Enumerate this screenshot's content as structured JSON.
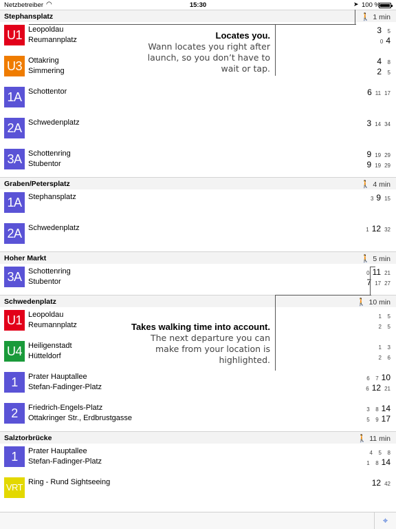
{
  "status_bar": {
    "carrier": "Netzbetreiber",
    "time": "15:30",
    "battery": "100 %"
  },
  "stations": [
    {
      "name": "Stephansplatz",
      "walk": "1 min",
      "rows": [
        {
          "line": "U1",
          "color": "#e2001a",
          "dests": [
            "Leopoldau",
            "Reumannplatz"
          ],
          "times": [
            [
              "3",
              "5"
            ],
            [
              "0",
              "4"
            ]
          ],
          "big": [
            0,
            1
          ]
        },
        {
          "line": "U3",
          "color": "#ef7c00",
          "dests": [
            "Ottakring",
            "Simmering"
          ],
          "times": [
            [
              "4",
              "8"
            ],
            [
              "2",
              "5"
            ]
          ],
          "big": [
            0,
            0
          ]
        },
        {
          "line": "1A",
          "color": "#5a53d6",
          "dests": [
            "Schottentor"
          ],
          "times": [
            [
              "6",
              "11",
              "17"
            ]
          ],
          "big": [
            0
          ]
        },
        {
          "line": "2A",
          "color": "#5a53d6",
          "dests": [
            "Schwedenplatz"
          ],
          "times": [
            [
              "3",
              "14",
              "34"
            ]
          ],
          "big": [
            0
          ]
        },
        {
          "line": "3A",
          "color": "#5a53d6",
          "dests": [
            "Schottenring",
            "Stubentor"
          ],
          "times": [
            [
              "9",
              "19",
              "29"
            ],
            [
              "9",
              "19",
              "29"
            ]
          ],
          "big": [
            0,
            0
          ]
        }
      ]
    },
    {
      "name": "Graben/Petersplatz",
      "walk": "4 min",
      "rows": [
        {
          "line": "1A",
          "color": "#5a53d6",
          "dests": [
            "Stephansplatz"
          ],
          "times": [
            [
              "3",
              "9",
              "15"
            ]
          ],
          "big": [
            1
          ]
        },
        {
          "line": "2A",
          "color": "#5a53d6",
          "dests": [
            "Schwedenplatz"
          ],
          "times": [
            [
              "1",
              "12",
              "32"
            ]
          ],
          "big": [
            1
          ]
        }
      ]
    },
    {
      "name": "Hoher Markt",
      "walk": "5 min",
      "rows": [
        {
          "line": "3A",
          "color": "#5a53d6",
          "dests": [
            "Schottenring",
            "Stubentor"
          ],
          "times": [
            [
              "0",
              "11",
              "21"
            ],
            [
              "7",
              "17",
              "27"
            ]
          ],
          "big": [
            1,
            0
          ]
        }
      ]
    },
    {
      "name": "Schwedenplatz",
      "walk": "10 min",
      "rows": [
        {
          "line": "U1",
          "color": "#e2001a",
          "dests": [
            "Leopoldau",
            "Reumannplatz"
          ],
          "times": [
            [
              "1",
              "5"
            ],
            [
              "2",
              "5"
            ]
          ],
          "big": [
            -1,
            -1
          ]
        },
        {
          "line": "U4",
          "color": "#1a9a3a",
          "dests": [
            "Heiligenstadt",
            "Hütteldorf"
          ],
          "times": [
            [
              "1",
              "3"
            ],
            [
              "2",
              "6"
            ]
          ],
          "big": [
            -1,
            -1
          ]
        },
        {
          "line": "1",
          "color": "#5a53d6",
          "dests": [
            "Prater Hauptallee",
            "Stefan-Fadinger-Platz"
          ],
          "times": [
            [
              "6",
              "7",
              "10"
            ],
            [
              "6",
              "12",
              "21"
            ]
          ],
          "big": [
            2,
            1
          ]
        },
        {
          "line": "2",
          "color": "#5a53d6",
          "dests": [
            "Friedrich-Engels-Platz",
            "Ottakringer Str., Erdbrustgasse"
          ],
          "times": [
            [
              "3",
              "8",
              "14"
            ],
            [
              "5",
              "9",
              "17"
            ]
          ],
          "big": [
            2,
            2
          ]
        }
      ]
    },
    {
      "name": "Salztorbrücke",
      "walk": "11 min",
      "rows": [
        {
          "line": "1",
          "color": "#5a53d6",
          "dests": [
            "Prater Hauptallee",
            "Stefan-Fadinger-Platz"
          ],
          "times": [
            [
              "4",
              "5",
              "8"
            ],
            [
              "1",
              "8",
              "14"
            ]
          ],
          "big": [
            -1,
            2
          ]
        },
        {
          "line": "VRT",
          "color": "#e3d800",
          "dests": [
            "Ring - Rund Sightseeing"
          ],
          "times": [
            [
              "12",
              "42"
            ]
          ],
          "big": [
            0
          ]
        }
      ]
    }
  ],
  "callouts": {
    "locates": {
      "title": "Locates you.",
      "body": [
        "Wann locates you right after",
        "launch, so you don’t have to",
        "wait or tap."
      ]
    },
    "walking": {
      "title": "Takes walking time into account.",
      "body": [
        "The next departure you can",
        "make from your location is",
        "highlighted."
      ]
    }
  },
  "icons": {
    "walk": "walking-person-icon",
    "map": "map-icon",
    "location": "location-arrow-icon",
    "wifi": "wifi-icon"
  }
}
